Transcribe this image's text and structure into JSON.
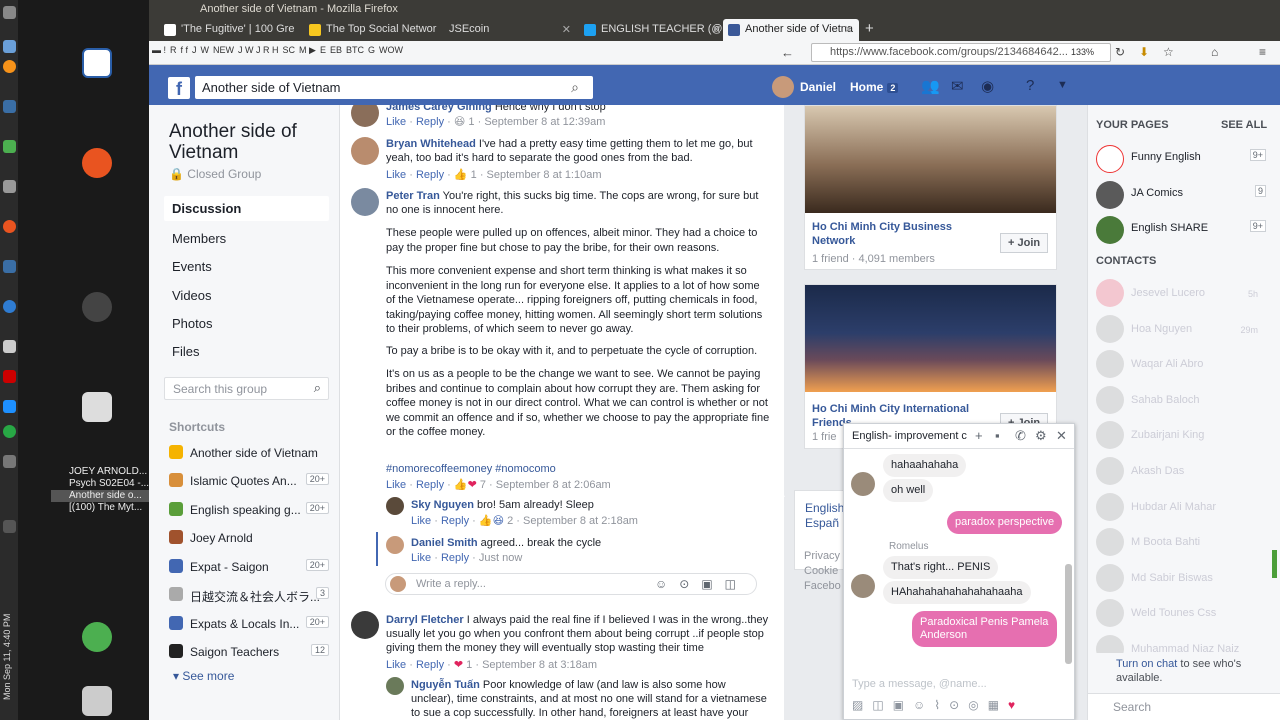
{
  "os": {
    "clock": "Mon Sep 11, 4:40 PM",
    "lang": "en"
  },
  "desktop": {
    "windows": [
      "JOEY ARNOLD...",
      "Psych S02E04 -...",
      "Another side o...",
      "[(100) The Myt..."
    ]
  },
  "browser": {
    "title": "Another side of Vietnam - Mozilla Firefox",
    "tabs": [
      {
        "label": "'The Fugitive' | 100 Gre",
        "color": "#fff"
      },
      {
        "label": "The Top Social Networ",
        "color": "#f7c71f"
      },
      {
        "label": "JSEcoin",
        "color": "#fff"
      },
      {
        "label": "ENGLISH TEACHER (@",
        "color": "#1da1f2"
      },
      {
        "label": "Another side of Vietna",
        "color": "#3b5998"
      }
    ],
    "bookmarks": [
      "NEW",
      "SC",
      "E",
      "EB",
      "BTC",
      "G",
      "WOW"
    ],
    "url": "https://www.facebook.com/groups/2134684642...",
    "zoom": "133%"
  },
  "fb": {
    "search_value": "Another side of Vietnam",
    "user": "Daniel",
    "home": "Home",
    "home_count": "2"
  },
  "group": {
    "name": "Another side of Vietnam",
    "type": "Closed Group",
    "nav": [
      "Discussion",
      "Members",
      "Events",
      "Videos",
      "Photos",
      "Files"
    ],
    "search_placeholder": "Search this group",
    "shortcuts_title": "Shortcuts",
    "shortcuts": [
      {
        "label": "Another side of Vietnam",
        "count": "",
        "color": "#f5b301"
      },
      {
        "label": "Islamic Quotes An...",
        "count": "20+",
        "color": "#d88f3b"
      },
      {
        "label": "English speaking g...",
        "count": "20+",
        "color": "#5a9e3a"
      },
      {
        "label": "Joey Arnold",
        "count": "",
        "color": "#a0522d"
      },
      {
        "label": "Expat - Saigon",
        "count": "20+",
        "color": "#4267b2"
      },
      {
        "label": "日越交流＆社会人ボラ...",
        "count": "3",
        "color": "#aaa"
      },
      {
        "label": "Expats & Locals In...",
        "count": "20+",
        "color": "#4267b2"
      },
      {
        "label": "Saigon Teachers",
        "count": "12",
        "color": "#222"
      }
    ],
    "see_more": "See more"
  },
  "feed": {
    "c0": {
      "name": "James Carey Gining",
      "text": " Hence why I don't stop",
      "like": "Like",
      "reply": "Reply",
      "count": "1",
      "time": "September 8 at 12:39am"
    },
    "c1": {
      "name": "Bryan Whitehead",
      "text": " I've had a pretty easy time getting them to let me go, but yeah, too bad it's hard to separate the good ones from the bad.",
      "like": "Like",
      "reply": "Reply",
      "count": "1",
      "time": "September 8 at 1:10am"
    },
    "c2": {
      "name": "Peter Tran",
      "text": " You're right, this sucks big time. The cops are wrong, for sure but no one is innocent here.",
      "p1": "These people were pulled up on offences, albeit minor. They had a choice to pay the proper fine but chose to pay the bribe, for their own reasons.",
      "p2": "This more convenient expense and short term thinking is what makes it so inconvenient in the long run for everyone else. It applies to a lot of how some of the Vietnamese operate... ripping foreigners off, putting chemicals in food, taking/paying coffee money, hitting women. All seemingly short term solutions to their problems, of which seem to never go away.",
      "p3": "To pay a bribe is to be okay with it, and to perpetuate the cycle of corruption.",
      "p4": "It's on us as a people to be the change we want to see. We cannot be paying bribes and continue to complain about how corrupt they are. Them asking for coffee money is not in our direct control. What we can control is whether or not we commit an offence and if so, whether we choose to pay the appropriate fine or the coffee money.",
      "tags": "#nomorecoffeemoney #nomocomo",
      "like": "Like",
      "reply": "Reply",
      "count": "7",
      "time": "September 8 at 2:06am"
    },
    "r1": {
      "name": "Sky Nguyen",
      "text": " bro! 5am already! Sleep",
      "like": "Like",
      "reply": "Reply",
      "count": "2",
      "time": "September 8 at 2:18am"
    },
    "r2": {
      "name": "Daniel Smith",
      "text": " agreed... break the cycle",
      "like": "Like",
      "reply": "Reply",
      "time": "Just now"
    },
    "reply_placeholder": "Write a reply...",
    "c3": {
      "name": "Darryl Fletcher",
      "text": " I always paid the real fine if I believed I was in the wrong..they usually let you go when you confront them about being corrupt ..if people stop giving them the money they will eventually stop wasting their time",
      "like": "Like",
      "reply": "Reply",
      "count": "1",
      "time": "September 8 at 3:18am"
    },
    "r3": {
      "name": "Nguyễn Tuấn",
      "text": " Poor knowledge of law (and law is also some how unclear), time constraints, and at most no one will stand for a vietnamese to sue a cop successfully. In other hand, foreigners at least have your"
    }
  },
  "suggested": [
    {
      "name": "Ho Chi Minh City Business Network",
      "stats": "1 friend · 4,091 members",
      "join": "Join"
    },
    {
      "name": "Ho Chi Minh City International Friends",
      "stats": "1 frie",
      "join": "Join"
    }
  ],
  "lang": {
    "l1": "English",
    "l2": "Españ"
  },
  "footer": [
    "Privacy",
    "Cookie",
    "Facebo"
  ],
  "sidebar": {
    "pages_title": "YOUR PAGES",
    "see_all": "SEE ALL",
    "pages": [
      {
        "name": "Funny English",
        "count": "9+"
      },
      {
        "name": "JA Comics",
        "count": "9"
      },
      {
        "name": "English SHARE",
        "count": "9+"
      }
    ],
    "contacts_title": "CONTACTS",
    "contacts": [
      {
        "name": "Jesevel Lucero",
        "time": "5h"
      },
      {
        "name": "Hoa Nguyen",
        "time": "29m"
      },
      {
        "name": "Waqar Ali Abro",
        "time": ""
      },
      {
        "name": "Sahab Baloch",
        "time": ""
      },
      {
        "name": "Zubairjani King",
        "time": ""
      },
      {
        "name": "Akash Das",
        "time": ""
      },
      {
        "name": "Hubdar Ali Mahar",
        "time": ""
      },
      {
        "name": "M Boota Bahti",
        "time": ""
      },
      {
        "name": "Md Sabir Biswas",
        "time": ""
      },
      {
        "name": "Weld Tounes Css",
        "time": ""
      },
      {
        "name": "Muhammad Niaz Naiz",
        "time": ""
      }
    ],
    "turn_on": "Turn on chat",
    "turn_on_rest": " to see who's available.",
    "search": "Search"
  },
  "chat": {
    "title": "English- improvement c",
    "m1": "hahaahahaha",
    "m2": "oh well",
    "m3": "paradox perspective",
    "sender": "Romelus",
    "m4": "That's right... PENIS",
    "m5": "HAhahahahahahahahaaha",
    "m6": "Paradoxical Penis Pamela Anderson",
    "placeholder": "Type a message, @name...",
    "accent": "#e66fb0"
  }
}
